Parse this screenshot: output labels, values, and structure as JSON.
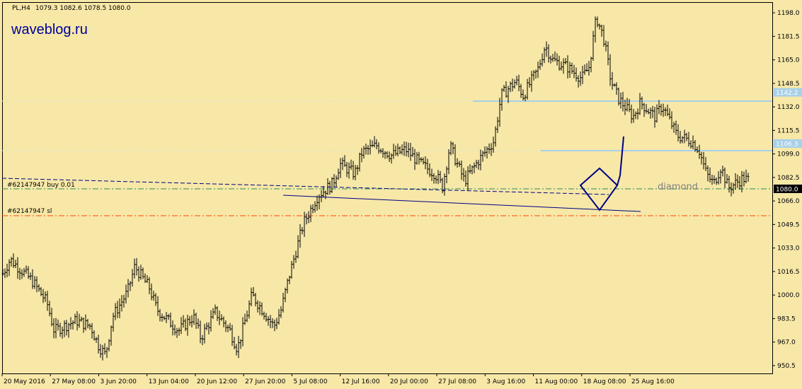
{
  "header": {
    "symbol": "PL,H4",
    "ohlc": "1079.3 1082.6 1078.5 1080.0",
    "watermark": "waveblog.ru"
  },
  "colors": {
    "background": "#f7e8a8",
    "bars": "#000000",
    "pattern": "#000080",
    "horizontal_level": "#a8d0e8",
    "buy_line": "#2e8b57",
    "sl_line": "#ff4500",
    "watermark": "#000099"
  },
  "chart_data": {
    "type": "ohlc",
    "instrument": "PL",
    "timeframe": "H4",
    "ylim": [
      945.0,
      1205.0
    ],
    "y_ticks": [
      "1198.0",
      "1181.5",
      "1165.0",
      "1148.5",
      "1132.0",
      "1115.5",
      "1099.0",
      "1082.5",
      "1066.0",
      "1049.5",
      "1033.0",
      "1016.5",
      "1000.0",
      "983.5",
      "967.0",
      "950.5"
    ],
    "x_ticks": [
      "20 May 2016",
      "27 May 08:00",
      "3 Jun 20:00",
      "13 Jun 04:00",
      "20 Jun 12:00",
      "27 Jun 20:00",
      "5 Jul 08:00",
      "12 Jul 16:00",
      "20 Jul 00:00",
      "27 Jul 08:00",
      "3 Aug 16:00",
      "11 Aug 00:00",
      "18 Aug 08:00",
      "25 Aug 16:00"
    ],
    "x_range": [
      "2016-05-20",
      "2016-09-02"
    ],
    "price_path": [
      [
        "2016-05-20",
        1015
      ],
      [
        "2016-05-21",
        1025
      ],
      [
        "2016-05-24",
        1010
      ],
      [
        "2016-05-26",
        995
      ],
      [
        "2016-05-27",
        975
      ],
      [
        "2016-05-30",
        982
      ],
      [
        "2016-06-01",
        978
      ],
      [
        "2016-06-02",
        965
      ],
      [
        "2016-06-03",
        958
      ],
      [
        "2016-06-04",
        985
      ],
      [
        "2016-06-06",
        1002
      ],
      [
        "2016-06-07",
        1020
      ],
      [
        "2016-06-09",
        1005
      ],
      [
        "2016-06-10",
        990
      ],
      [
        "2016-06-13",
        975
      ],
      [
        "2016-06-15",
        985
      ],
      [
        "2016-06-16",
        970
      ],
      [
        "2016-06-18",
        988
      ],
      [
        "2016-06-20",
        975
      ],
      [
        "2016-06-21",
        962
      ],
      [
        "2016-06-23",
        1000
      ],
      [
        "2016-06-26",
        978
      ],
      [
        "2016-06-27",
        990
      ],
      [
        "2016-06-28",
        1012
      ],
      [
        "2016-06-30",
        1050
      ],
      [
        "2016-07-02",
        1070
      ],
      [
        "2016-07-04",
        1078
      ],
      [
        "2016-07-05",
        1092
      ],
      [
        "2016-07-07",
        1085
      ],
      [
        "2016-07-08",
        1100
      ],
      [
        "2016-07-10",
        1105
      ],
      [
        "2016-07-12",
        1098
      ],
      [
        "2016-07-14",
        1102
      ],
      [
        "2016-07-16",
        1092
      ],
      [
        "2016-07-18",
        1085
      ],
      [
        "2016-07-19",
        1076
      ],
      [
        "2016-07-20",
        1105
      ],
      [
        "2016-07-21",
        1092
      ],
      [
        "2016-07-22",
        1080
      ],
      [
        "2016-07-24",
        1095
      ],
      [
        "2016-07-26",
        1108
      ],
      [
        "2016-07-27",
        1140
      ],
      [
        "2016-07-29",
        1150
      ],
      [
        "2016-07-30",
        1140
      ],
      [
        "2016-08-01",
        1158
      ],
      [
        "2016-08-02",
        1175
      ],
      [
        "2016-08-03",
        1165
      ],
      [
        "2016-08-05",
        1160
      ],
      [
        "2016-08-07",
        1152
      ],
      [
        "2016-08-08",
        1160
      ],
      [
        "2016-08-09",
        1195
      ],
      [
        "2016-08-10",
        1180
      ],
      [
        "2016-08-11",
        1150
      ],
      [
        "2016-08-12",
        1138
      ],
      [
        "2016-08-14",
        1125
      ],
      [
        "2016-08-15",
        1135
      ],
      [
        "2016-08-17",
        1125
      ],
      [
        "2016-08-18",
        1133
      ],
      [
        "2016-08-20",
        1112
      ],
      [
        "2016-08-22",
        1108
      ],
      [
        "2016-08-23",
        1102
      ],
      [
        "2016-08-24",
        1085
      ],
      [
        "2016-08-25",
        1078
      ],
      [
        "2016-08-26",
        1090
      ],
      [
        "2016-08-27",
        1075
      ],
      [
        "2016-08-29",
        1082
      ],
      [
        "2016-08-30",
        1080
      ]
    ],
    "horizontal_levels": [
      {
        "label": "1142.2",
        "price": 1142.2
      },
      {
        "label": "1106.3",
        "price": 1106.3
      }
    ],
    "order_lines": [
      {
        "label": "#62147947 buy 0.01",
        "price": 1080.0,
        "style": "dash-dot"
      },
      {
        "label": "#62147947 sl",
        "price": 1061.0,
        "style": "dash-dot"
      }
    ],
    "current_price_label": "1080.0",
    "annotation": "diamond"
  }
}
